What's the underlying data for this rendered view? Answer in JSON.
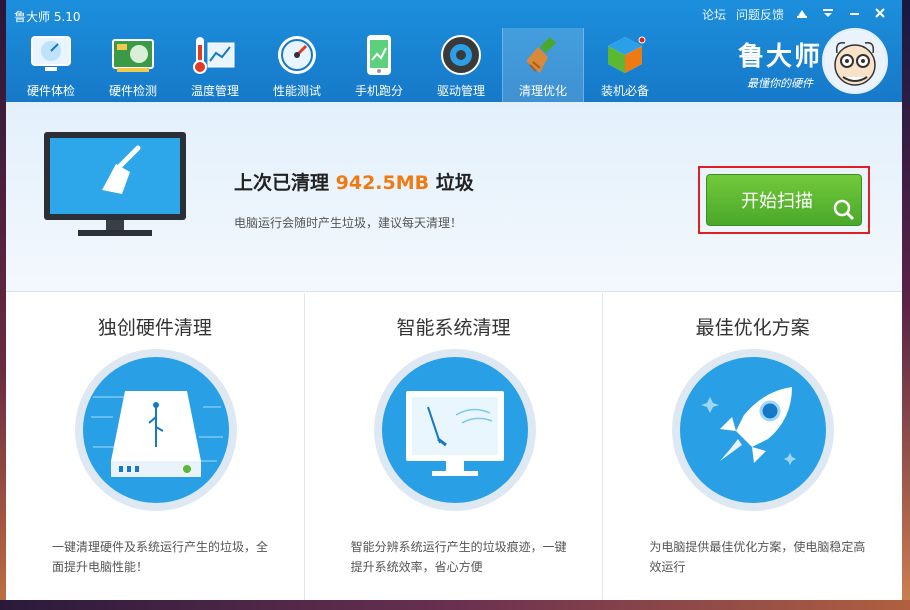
{
  "app": {
    "title": "鲁大师 5.10",
    "links": [
      "论坛",
      "问题反馈"
    ]
  },
  "nav": {
    "items": [
      {
        "label": "硬件体检",
        "icon": "monitor-check-icon",
        "active": false
      },
      {
        "label": "硬件检测",
        "icon": "circuit-board-icon",
        "active": false
      },
      {
        "label": "温度管理",
        "icon": "thermometer-icon",
        "active": false
      },
      {
        "label": "性能测试",
        "icon": "speedometer-icon",
        "active": false
      },
      {
        "label": "手机跑分",
        "icon": "phone-icon",
        "active": false
      },
      {
        "label": "驱动管理",
        "icon": "gear-icon",
        "active": false
      },
      {
        "label": "清理优化",
        "icon": "broom-icon",
        "active": true
      },
      {
        "label": "装机必备",
        "icon": "package-cube-icon",
        "active": false
      }
    ]
  },
  "brand": {
    "name": "鲁大师",
    "slogan": "最懂你的硬件"
  },
  "summary": {
    "title_prefix": "上次已清理",
    "size": "942.5MB",
    "title_suffix": "垃圾",
    "tip": "电脑运行会随时产生垃圾，建议每天清理！",
    "scan_button": "开始扫描"
  },
  "cards": [
    {
      "title": "独创硬件清理",
      "desc": "一键清理硬件及系统运行产生的垃圾，全面提升电脑性能！",
      "icon": "hard-drive-usb-icon"
    },
    {
      "title": "智能系统清理",
      "desc": "智能分辨系统运行产生的垃圾痕迹，一键提升系统效率，省心方便",
      "icon": "monitor-sweep-icon"
    },
    {
      "title": "最佳优化方案",
      "desc": "为电脑提供最佳优化方案，使电脑稳定高效运行",
      "icon": "rocket-icon"
    }
  ],
  "colors": {
    "header": "#1c8fdc",
    "accent_orange": "#f07a12",
    "scan_green": "#5cb832",
    "highlight_red": "#e02020",
    "card_blue": "#29a0e6"
  }
}
